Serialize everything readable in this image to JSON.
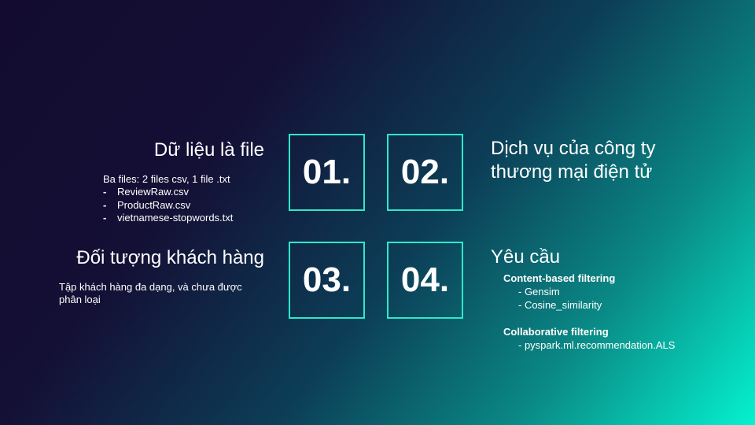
{
  "cards": [
    {
      "number": "01.",
      "title": "Dữ liệu là file"
    },
    {
      "number": "02.",
      "title_lines": [
        "Dịch vụ của công ty",
        "thương mại điện tử"
      ]
    },
    {
      "number": "03.",
      "title": "Đối tượng khách hàng"
    },
    {
      "number": "04.",
      "title": "Yêu cầu"
    }
  ],
  "data_files": {
    "intro": "Ba files: 2 files csv, 1 file .txt",
    "bullet": "-",
    "files": [
      "ReviewRaw.csv",
      "ProductRaw.csv",
      "vietnamese-stopwords.txt"
    ]
  },
  "customers": {
    "description": "Tập khách hàng đa dạng, và chưa được phân loại"
  },
  "requirements": {
    "groups": [
      {
        "title": "Content-based filtering",
        "items": [
          "- Gensim",
          "- Cosine_similarity"
        ]
      },
      {
        "title": "Collaborative filtering",
        "items": [
          "- pyspark.ml.recommendation.ALS"
        ]
      }
    ]
  },
  "colors": {
    "box_border": "#2ee8c8",
    "background_dark": "#130c30",
    "background_light": "#05f2cf",
    "text": "#ffffff"
  }
}
